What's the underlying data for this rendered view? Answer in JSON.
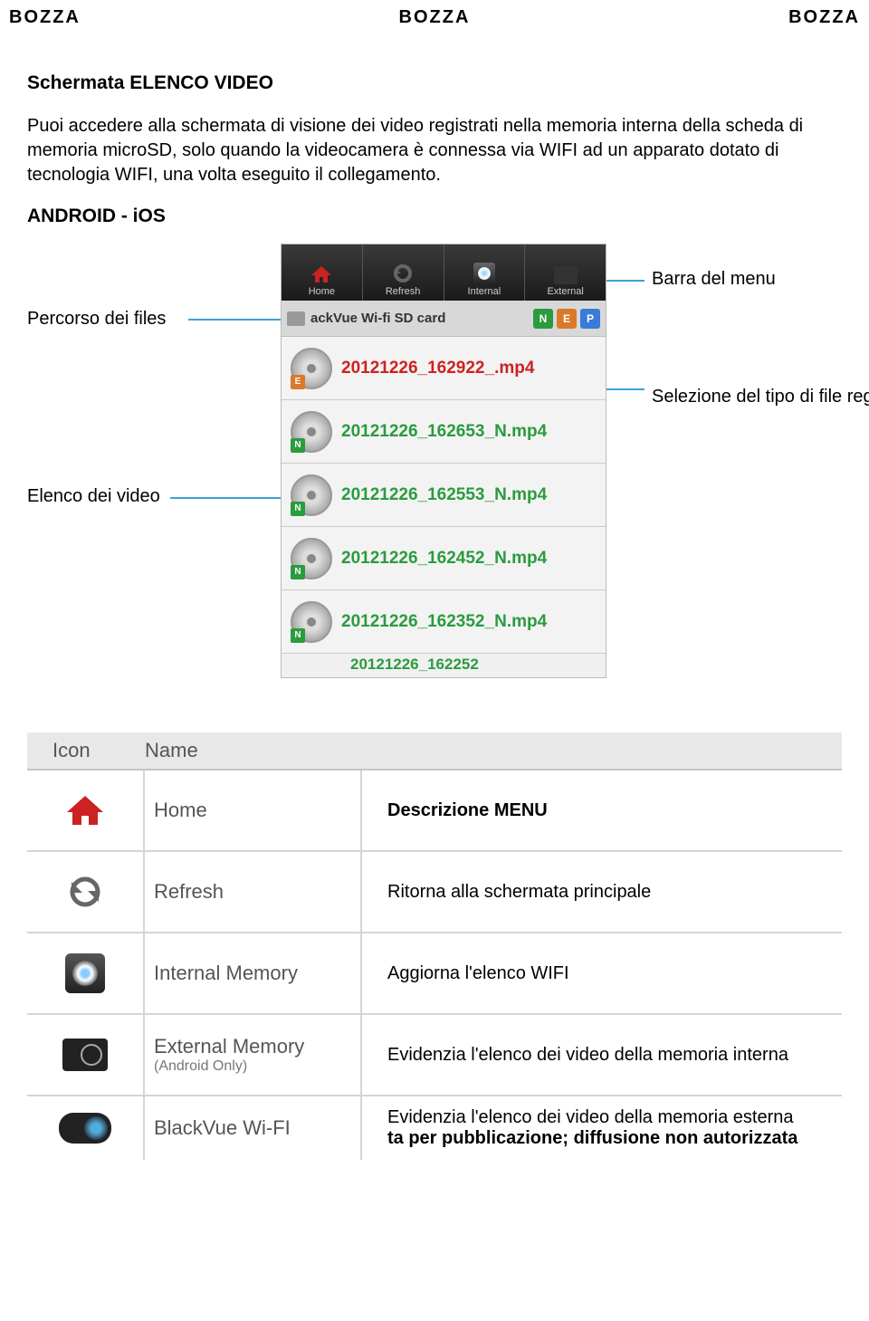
{
  "watermark": "BOZZA",
  "doc": {
    "title": "Schermata ELENCO VIDEO",
    "intro": "Puoi accedere alla schermata di visione dei video registrati nella memoria interna della scheda di memoria microSD, solo quando la videocamera è connessa via WIFI ad un apparato dotato di tecnologia WIFI, una volta eseguito il collegamento.",
    "subhead": "ANDROID - iOS"
  },
  "callouts": {
    "menu_bar": "Barra del menu",
    "file_path": "Percorso dei files",
    "file_type": "Selezione del tipo di file registrati",
    "video_list": "Elenco dei video"
  },
  "phone": {
    "menu": {
      "home": "Home",
      "refresh": "Refresh",
      "internal": "Internal",
      "external": "External"
    },
    "path": {
      "text": "ackVue Wi-fi SD card",
      "badges": [
        "N",
        "E",
        "P"
      ]
    },
    "files": [
      {
        "name": "20121226_162922_.mp4",
        "color": "red",
        "badge": "E"
      },
      {
        "name": "20121226_162653_N.mp4",
        "color": "green",
        "badge": "N"
      },
      {
        "name": "20121226_162553_N.mp4",
        "color": "green",
        "badge": "N"
      },
      {
        "name": "20121226_162452_N.mp4",
        "color": "green",
        "badge": "N"
      },
      {
        "name": "20121226_162352_N.mp4",
        "color": "green",
        "badge": "N"
      }
    ],
    "partial_file": "20121226_162252"
  },
  "menu_table": {
    "head": {
      "icon": "Icon",
      "name": "Name"
    },
    "desc_title": "Descrizione MENU",
    "rows": [
      {
        "name": "Home",
        "desc": "Ritorna alla schermata principale"
      },
      {
        "name": "Refresh",
        "desc": "Aggiorna l'elenco WIFI"
      },
      {
        "name": "Internal Memory",
        "desc": "Evidenzia l'elenco dei video  della memoria interna"
      },
      {
        "name": "External Memory",
        "sub": "(Android Only)",
        "desc": "Evidenzia l'elenco dei video  della memoria esterna"
      },
      {
        "name": "BlackVue Wi-FI",
        "desc": ""
      }
    ],
    "footer_red": "ta per pubblicazione; diffusione non autorizzata"
  }
}
